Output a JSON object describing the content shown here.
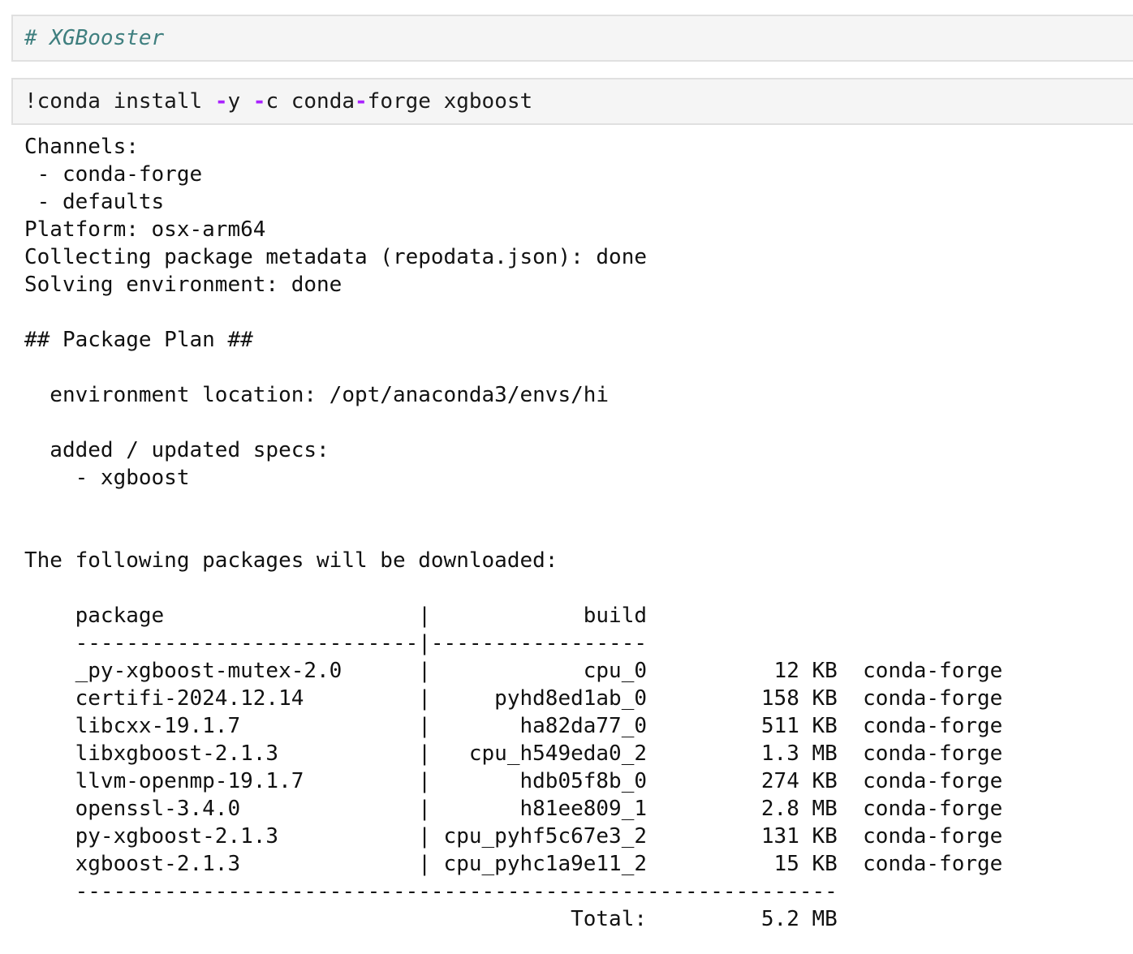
{
  "markdown_cell": {
    "source": "# XGBooster"
  },
  "code_cell": {
    "prefix": "!conda install ",
    "flag_y_dash": "-",
    "flag_y": "y ",
    "flag_c_dash": "-",
    "flag_c": "c conda",
    "hyphen": "-",
    "suffix": "forge xgboost"
  },
  "output": {
    "lines": [
      "Channels:",
      " - conda-forge",
      " - defaults",
      "Platform: osx-arm64",
      "Collecting package metadata (repodata.json): done",
      "Solving environment: done",
      "",
      "## Package Plan ##",
      "",
      "  environment location: /opt/anaconda3/envs/hi",
      "",
      "  added / updated specs:",
      "    - xgboost",
      "",
      "",
      "The following packages will be downloaded:",
      "",
      "    package                    |            build",
      "    ---------------------------|-----------------",
      "    _py-xgboost-mutex-2.0      |            cpu_0          12 KB  conda-forge",
      "    certifi-2024.12.14         |     pyhd8ed1ab_0         158 KB  conda-forge",
      "    libcxx-19.1.7              |       ha82da77_0         511 KB  conda-forge",
      "    libxgboost-2.1.3           |   cpu_h549eda0_2         1.3 MB  conda-forge",
      "    llvm-openmp-19.1.7         |       hdb05f8b_0         274 KB  conda-forge",
      "    openssl-3.4.0              |       h81ee809_1         2.8 MB  conda-forge",
      "    py-xgboost-2.1.3           | cpu_pyhf5c67e3_2         131 KB  conda-forge",
      "    xgboost-2.1.3              | cpu_pyhc1a9e11_2          15 KB  conda-forge",
      "    ------------------------------------------------------------",
      "                                           Total:         5.2 MB"
    ]
  }
}
